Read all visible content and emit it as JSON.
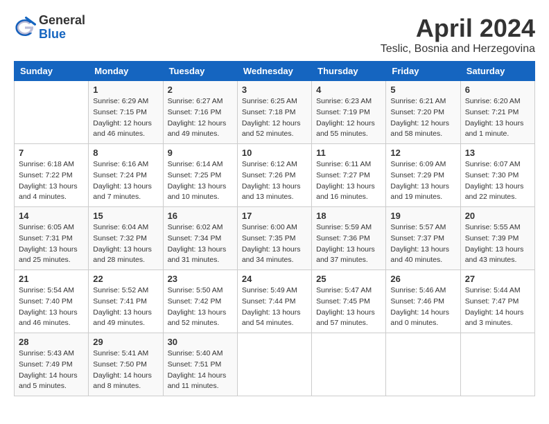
{
  "app": {
    "logo_general": "General",
    "logo_blue": "Blue",
    "month_title": "April 2024",
    "location": "Teslic, Bosnia and Herzegovina"
  },
  "calendar": {
    "headers": [
      "Sunday",
      "Monday",
      "Tuesday",
      "Wednesday",
      "Thursday",
      "Friday",
      "Saturday"
    ],
    "weeks": [
      [
        {
          "day": "",
          "info": ""
        },
        {
          "day": "1",
          "info": "Sunrise: 6:29 AM\nSunset: 7:15 PM\nDaylight: 12 hours\nand 46 minutes."
        },
        {
          "day": "2",
          "info": "Sunrise: 6:27 AM\nSunset: 7:16 PM\nDaylight: 12 hours\nand 49 minutes."
        },
        {
          "day": "3",
          "info": "Sunrise: 6:25 AM\nSunset: 7:18 PM\nDaylight: 12 hours\nand 52 minutes."
        },
        {
          "day": "4",
          "info": "Sunrise: 6:23 AM\nSunset: 7:19 PM\nDaylight: 12 hours\nand 55 minutes."
        },
        {
          "day": "5",
          "info": "Sunrise: 6:21 AM\nSunset: 7:20 PM\nDaylight: 12 hours\nand 58 minutes."
        },
        {
          "day": "6",
          "info": "Sunrise: 6:20 AM\nSunset: 7:21 PM\nDaylight: 13 hours\nand 1 minute."
        }
      ],
      [
        {
          "day": "7",
          "info": "Sunrise: 6:18 AM\nSunset: 7:22 PM\nDaylight: 13 hours\nand 4 minutes."
        },
        {
          "day": "8",
          "info": "Sunrise: 6:16 AM\nSunset: 7:24 PM\nDaylight: 13 hours\nand 7 minutes."
        },
        {
          "day": "9",
          "info": "Sunrise: 6:14 AM\nSunset: 7:25 PM\nDaylight: 13 hours\nand 10 minutes."
        },
        {
          "day": "10",
          "info": "Sunrise: 6:12 AM\nSunset: 7:26 PM\nDaylight: 13 hours\nand 13 minutes."
        },
        {
          "day": "11",
          "info": "Sunrise: 6:11 AM\nSunset: 7:27 PM\nDaylight: 13 hours\nand 16 minutes."
        },
        {
          "day": "12",
          "info": "Sunrise: 6:09 AM\nSunset: 7:29 PM\nDaylight: 13 hours\nand 19 minutes."
        },
        {
          "day": "13",
          "info": "Sunrise: 6:07 AM\nSunset: 7:30 PM\nDaylight: 13 hours\nand 22 minutes."
        }
      ],
      [
        {
          "day": "14",
          "info": "Sunrise: 6:05 AM\nSunset: 7:31 PM\nDaylight: 13 hours\nand 25 minutes."
        },
        {
          "day": "15",
          "info": "Sunrise: 6:04 AM\nSunset: 7:32 PM\nDaylight: 13 hours\nand 28 minutes."
        },
        {
          "day": "16",
          "info": "Sunrise: 6:02 AM\nSunset: 7:34 PM\nDaylight: 13 hours\nand 31 minutes."
        },
        {
          "day": "17",
          "info": "Sunrise: 6:00 AM\nSunset: 7:35 PM\nDaylight: 13 hours\nand 34 minutes."
        },
        {
          "day": "18",
          "info": "Sunrise: 5:59 AM\nSunset: 7:36 PM\nDaylight: 13 hours\nand 37 minutes."
        },
        {
          "day": "19",
          "info": "Sunrise: 5:57 AM\nSunset: 7:37 PM\nDaylight: 13 hours\nand 40 minutes."
        },
        {
          "day": "20",
          "info": "Sunrise: 5:55 AM\nSunset: 7:39 PM\nDaylight: 13 hours\nand 43 minutes."
        }
      ],
      [
        {
          "day": "21",
          "info": "Sunrise: 5:54 AM\nSunset: 7:40 PM\nDaylight: 13 hours\nand 46 minutes."
        },
        {
          "day": "22",
          "info": "Sunrise: 5:52 AM\nSunset: 7:41 PM\nDaylight: 13 hours\nand 49 minutes."
        },
        {
          "day": "23",
          "info": "Sunrise: 5:50 AM\nSunset: 7:42 PM\nDaylight: 13 hours\nand 52 minutes."
        },
        {
          "day": "24",
          "info": "Sunrise: 5:49 AM\nSunset: 7:44 PM\nDaylight: 13 hours\nand 54 minutes."
        },
        {
          "day": "25",
          "info": "Sunrise: 5:47 AM\nSunset: 7:45 PM\nDaylight: 13 hours\nand 57 minutes."
        },
        {
          "day": "26",
          "info": "Sunrise: 5:46 AM\nSunset: 7:46 PM\nDaylight: 14 hours\nand 0 minutes."
        },
        {
          "day": "27",
          "info": "Sunrise: 5:44 AM\nSunset: 7:47 PM\nDaylight: 14 hours\nand 3 minutes."
        }
      ],
      [
        {
          "day": "28",
          "info": "Sunrise: 5:43 AM\nSunset: 7:49 PM\nDaylight: 14 hours\nand 5 minutes."
        },
        {
          "day": "29",
          "info": "Sunrise: 5:41 AM\nSunset: 7:50 PM\nDaylight: 14 hours\nand 8 minutes."
        },
        {
          "day": "30",
          "info": "Sunrise: 5:40 AM\nSunset: 7:51 PM\nDaylight: 14 hours\nand 11 minutes."
        },
        {
          "day": "",
          "info": ""
        },
        {
          "day": "",
          "info": ""
        },
        {
          "day": "",
          "info": ""
        },
        {
          "day": "",
          "info": ""
        }
      ]
    ]
  }
}
